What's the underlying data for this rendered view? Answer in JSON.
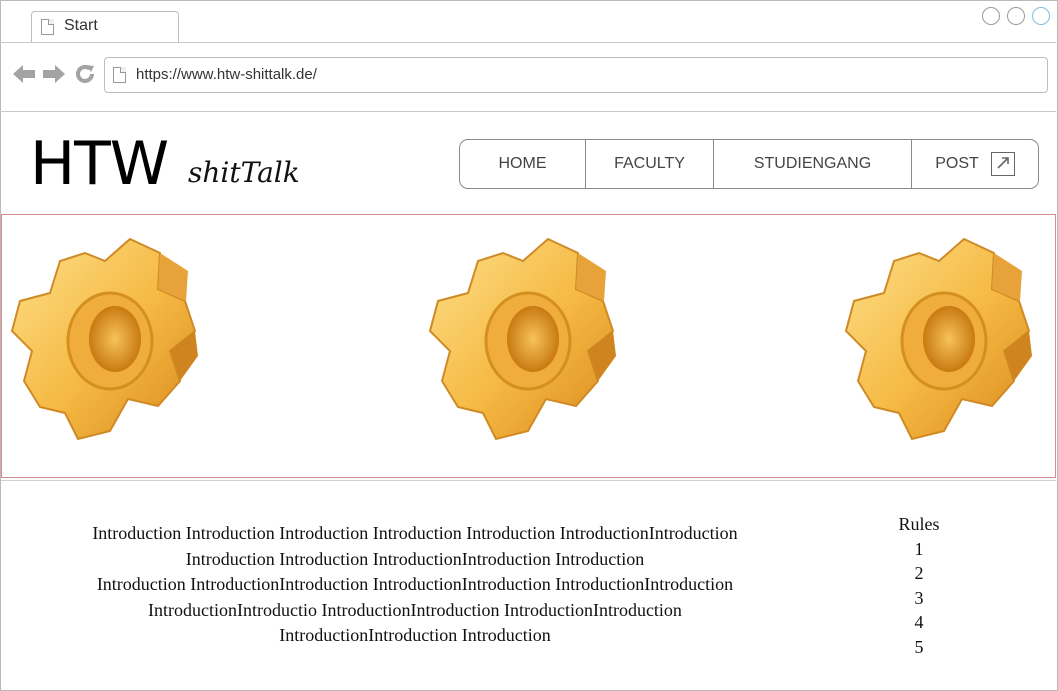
{
  "browser": {
    "tab_title": "Start",
    "url": "https://www.htw-shittalk.de/",
    "tab_icon": "document-icon",
    "nav_icons": [
      "back-icon",
      "forward-icon",
      "refresh-icon"
    ]
  },
  "header": {
    "logo_main": "HTW",
    "logo_sub": "shitTalk",
    "nav": {
      "home": "HOME",
      "faculty": "FACULTY",
      "studiengang": "STUDIENGANG",
      "post": "POST"
    }
  },
  "banner": {
    "images": [
      "gear-icon",
      "gear-icon",
      "gear-icon"
    ],
    "colors": {
      "gear_light": "#fbd36a",
      "gear_dark": "#d48a1c"
    }
  },
  "content": {
    "intro_lines": [
      "Introduction Introduction Introduction Introduction Introduction IntroductionIntroduction",
      "Introduction Introduction IntroductionIntroduction Introduction",
      "Introduction IntroductionIntroduction IntroductionIntroduction IntroductionIntroduction",
      "IntroductionIntroductio IntroductionIntroduction IntroductionIntroduction",
      "IntroductionIntroduction Introduction"
    ],
    "rules": {
      "title": "Rules",
      "items": [
        "1",
        "2",
        "3",
        "4",
        "5"
      ]
    }
  }
}
